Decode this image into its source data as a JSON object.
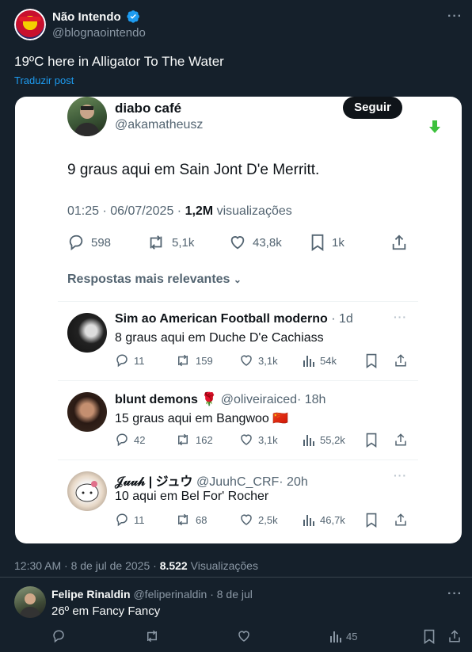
{
  "main_tweet": {
    "author_name": "Não Intendo",
    "author_handle": "@blognaointendo",
    "text": "19ºC here in Alligator To The Water",
    "translate_label": "Traduzir post",
    "timestamp": "12:30 AM · 8 de jul de 2025 ·",
    "views_count": "8.522",
    "views_label": "Visualizações"
  },
  "screenshot": {
    "author_name": "diabo café",
    "author_handle": "@akamatheusz",
    "follow_label": "Seguir",
    "text": "9 graus aqui em Sain Jont D'e Merritt.",
    "timestamp": "01:25 · 06/07/2025 ·",
    "views_count": "1,2M",
    "views_label": "visualizações",
    "replies": "598",
    "reposts": "5,1k",
    "likes": "43,8k",
    "bookmarks": "1k",
    "sort_label": "Respostas mais relevantes",
    "reply_items": [
      {
        "name": "Sim ao American Football moderno",
        "handle": "",
        "time": "· 1d",
        "text": "8 graus aqui em Duche D'e Cachiass",
        "replies": "11",
        "reposts": "159",
        "likes": "3,1k",
        "views": "54k"
      },
      {
        "name": "blunt demons 🌹",
        "handle": "@oliveiraiced",
        "time": "· 18h",
        "text": "15 graus aqui em Bangwoo 🇨🇳",
        "replies": "42",
        "reposts": "162",
        "likes": "3,1k",
        "views": "55,2k"
      },
      {
        "name": "𝒥𝓊𝓊𝒽 | ジュウ",
        "handle": "@JuuhC_CRF",
        "time": "· 20h",
        "text": "10 aqui em Bel For' Rocher",
        "replies": "11",
        "reposts": "68",
        "likes": "2,5k",
        "views": "46,7k"
      }
    ]
  },
  "reply": {
    "author_name": "Felipe Rinaldin",
    "author_handle": "@feliperinaldin",
    "date": "· 8 de jul",
    "text": "26º em Fancy Fancy",
    "views": "45"
  },
  "colors": {
    "background": "#15202b",
    "accent": "#1d9bf0",
    "muted": "#8b98a5"
  }
}
